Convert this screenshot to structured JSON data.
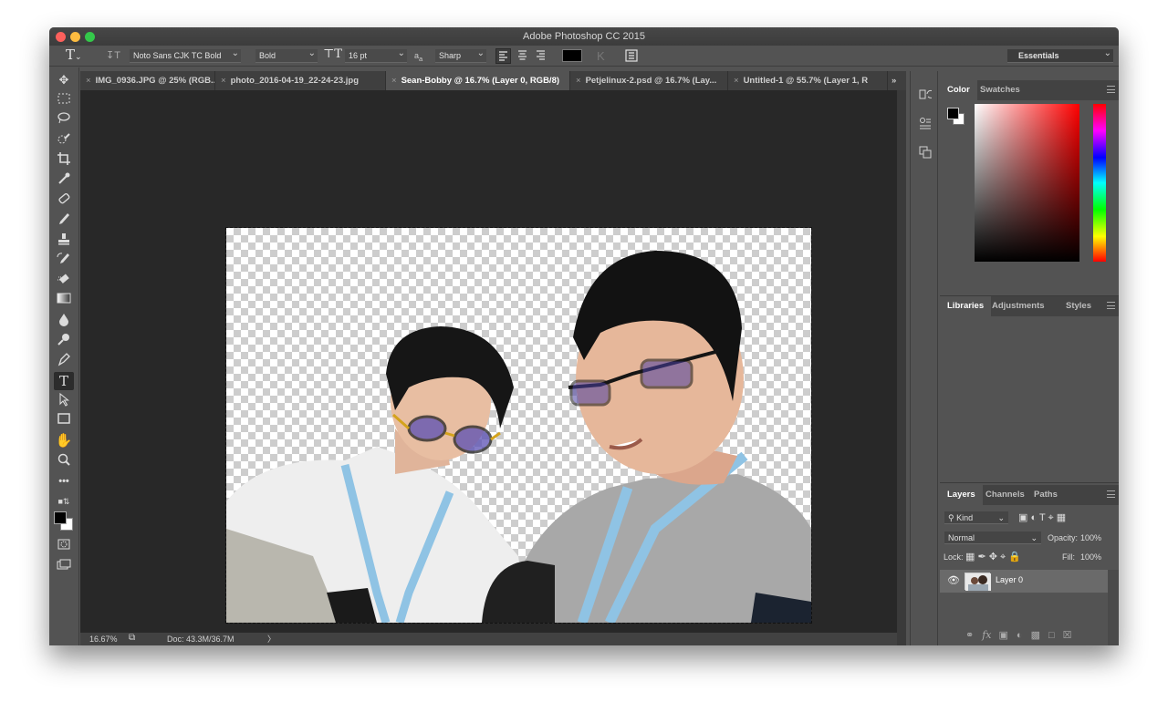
{
  "window": {
    "title": "Adobe Photoshop CC 2015"
  },
  "options_bar": {
    "font_family": "Noto Sans CJK TC Bold",
    "font_style": "Bold",
    "font_size": "16 pt",
    "aa_icon_text": "a",
    "aa_subtext": "a",
    "anti_alias": "Sharp",
    "workspace": "Essentials"
  },
  "doc_tabs": [
    {
      "label": "IMG_0936.JPG @ 25% (RGB...",
      "active": false
    },
    {
      "label": "photo_2016-04-19_22-24-23.jpg",
      "active": false
    },
    {
      "label": "Sean-Bobby @ 16.7% (Layer 0, RGB/8)",
      "active": true
    },
    {
      "label": "Petjelinux-2.psd @ 16.7% (Lay...",
      "active": false
    },
    {
      "label": "Untitled-1 @ 55.7% (Layer 1, R",
      "active": false
    }
  ],
  "tabs_overflow": "»",
  "status_bar": {
    "zoom": "16.67%",
    "doc_info": "Doc: 43.3M/36.7M",
    "arrow": "〉"
  },
  "color_panel": {
    "tabs": [
      "Color",
      "Swatches"
    ],
    "foreground": "#000000",
    "background": "#ffffff",
    "hue_base": "#ff0000"
  },
  "libraries_panel": {
    "tabs": [
      "Libraries",
      "Adjustments",
      "Styles"
    ]
  },
  "layers_panel": {
    "tabs": [
      "Layers",
      "Channels",
      "Paths"
    ],
    "filter_label": "Kind",
    "blend_mode": "Normal",
    "opacity_label": "Opacity:",
    "opacity_value": "100%",
    "lock_label": "Lock:",
    "fill_label": "Fill:",
    "fill_value": "100%",
    "layers": [
      {
        "name": "Layer 0",
        "visible": true
      }
    ]
  }
}
